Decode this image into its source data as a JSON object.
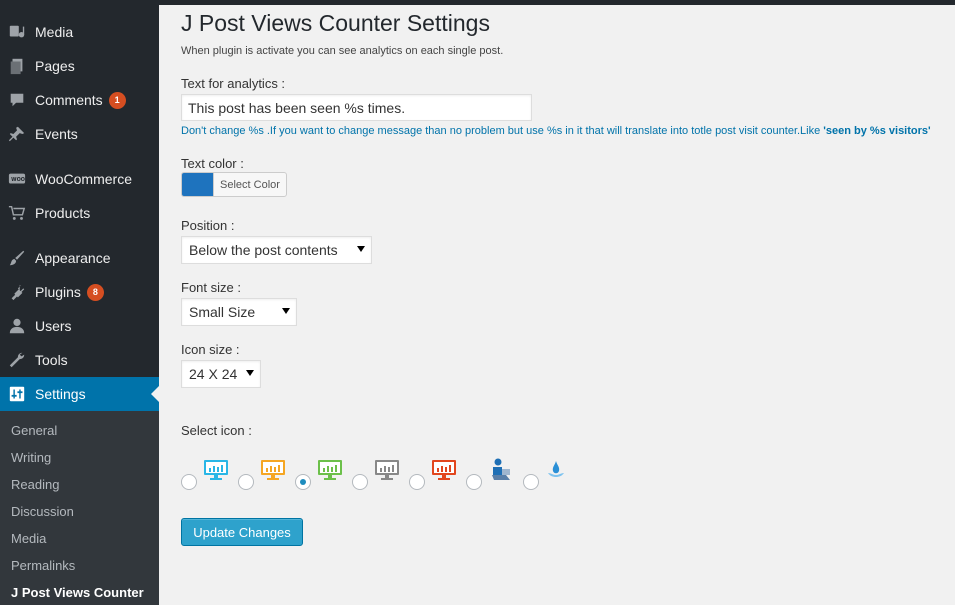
{
  "sidebar": {
    "items": [
      {
        "label": "Media",
        "icon": "media-icon"
      },
      {
        "label": "Pages",
        "icon": "pages-icon"
      },
      {
        "label": "Comments",
        "icon": "comments-icon",
        "badge": "1"
      },
      {
        "label": "Events",
        "icon": "pin-icon"
      },
      {
        "label": "WooCommerce",
        "icon": "woocommerce-icon"
      },
      {
        "label": "Products",
        "icon": "cart-icon"
      },
      {
        "label": "Appearance",
        "icon": "brush-icon"
      },
      {
        "label": "Plugins",
        "icon": "plugin-icon",
        "badge": "8"
      },
      {
        "label": "Users",
        "icon": "user-icon"
      },
      {
        "label": "Tools",
        "icon": "wrench-icon"
      },
      {
        "label": "Settings",
        "icon": "settings-icon",
        "active": true
      }
    ],
    "submenu": [
      "General",
      "Writing",
      "Reading",
      "Discussion",
      "Media",
      "Permalinks",
      "J Post Views Counter"
    ]
  },
  "page": {
    "title": "J Post Views Counter Settings",
    "description": "When plugin is activate you can see analytics on each single post.",
    "text_label": "Text for analytics :",
    "text_value": "This post has been seen %s times.",
    "hint_prefix": "Don't change %s .If you want to change message than no problem but use %s in it that will translate into totle post visit counter.Like ",
    "hint_example": "'seen by %s visitors'",
    "color_label": "Text color :",
    "color_value": "#1e73be",
    "color_button": "Select Color",
    "position_label": "Position :",
    "position_value": "Below the post contents",
    "font_label": "Font size :",
    "font_value": "Small Size",
    "icon_size_label": "Icon size :",
    "icon_size_value": "24 X 24",
    "select_icon_label": "Select icon :",
    "icons": [
      {
        "name": "monitor-chart-blue-icon",
        "color": "#29b6e6",
        "checked": false
      },
      {
        "name": "monitor-chart-orange-icon",
        "color": "#f5a623",
        "checked": false
      },
      {
        "name": "monitor-chart-green-icon",
        "color": "#6cc04a",
        "checked": true
      },
      {
        "name": "monitor-chart-gray-icon",
        "color": "#888888",
        "checked": false
      },
      {
        "name": "monitor-chart-red-icon",
        "color": "#e2461e",
        "checked": false
      },
      {
        "name": "person-laptop-icon",
        "color": "#1e6fb5",
        "checked": false
      },
      {
        "name": "water-splash-icon",
        "color": "#2a8fd6",
        "checked": false
      }
    ],
    "submit_label": "Update Changes"
  }
}
